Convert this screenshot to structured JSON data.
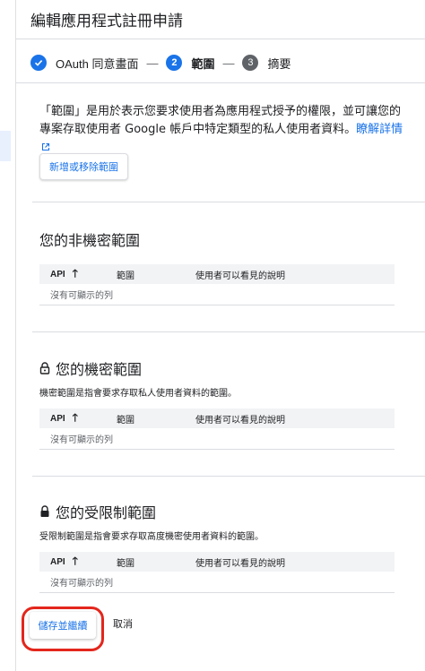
{
  "header": {
    "title": "編輯應用程式註冊申請"
  },
  "stepper": {
    "steps": [
      {
        "number": "1",
        "label": "OAuth 同意畫面",
        "state": "done"
      },
      {
        "number": "2",
        "label": "範圍",
        "state": "active"
      },
      {
        "number": "3",
        "label": "摘要",
        "state": "todo"
      }
    ],
    "separator": "—"
  },
  "intro": {
    "text": "「範圍」是用於表示您要求使用者為應用程式授予的權限，並可讓您的專案存取使用者 Google 帳戶中特定類型的私人使用者資料。",
    "link_label": "瞭解詳情"
  },
  "add_scope_button": "新增或移除範圍",
  "columns": {
    "api": "API",
    "scope": "範圍",
    "description": "使用者可以看見的說明"
  },
  "sections": {
    "non_sensitive": {
      "title": "您的非機密範圍",
      "empty": "沒有可顯示的列"
    },
    "sensitive": {
      "title": "您的機密範圍",
      "description": "機密範圍是指會要求存取私人使用者資料的範圍。",
      "empty": "沒有可顯示的列"
    },
    "restricted": {
      "title": "您的受限制範圍",
      "description": "受限制範圍是指會要求存取高度機密使用者資料的範圍。",
      "empty": "沒有可顯示的列"
    }
  },
  "footer": {
    "save_label": "儲存並繼續",
    "cancel_label": "取消"
  },
  "colors": {
    "accent": "#1a73e8",
    "highlight": "#e3261c",
    "muted": "#5f6368"
  }
}
